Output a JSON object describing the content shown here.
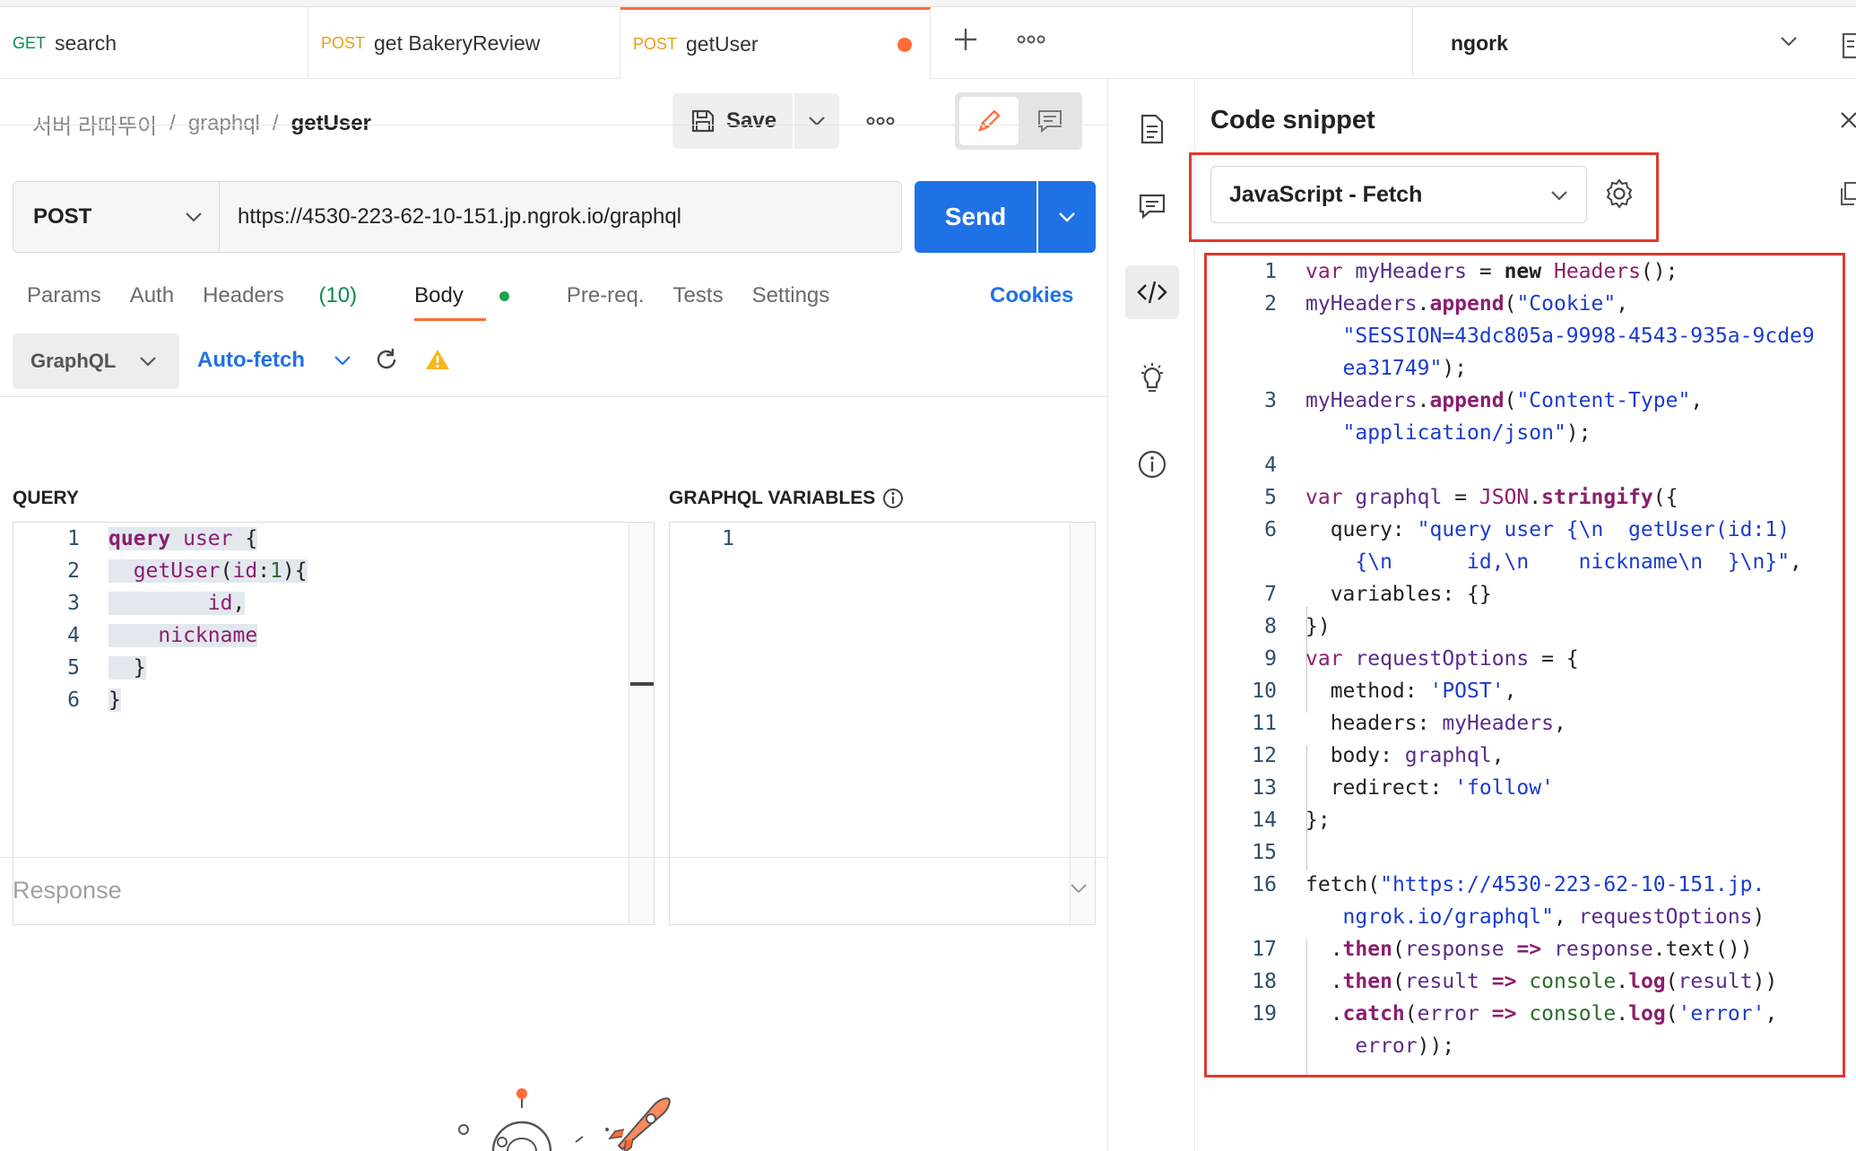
{
  "tabs": [
    {
      "method": "GET",
      "name": "search"
    },
    {
      "method": "POST",
      "name": "get BakeryReview"
    },
    {
      "method": "POST",
      "name": "getUser"
    }
  ],
  "environment": "ngork",
  "breadcrumb": {
    "workspace": "서버 라따뚜이",
    "collection": "graphql",
    "request": "getUser"
  },
  "toolbar": {
    "save_label": "Save"
  },
  "request": {
    "method": "POST",
    "url": "https://4530-223-62-10-151.jp.ngrok.io/graphql",
    "send_label": "Send"
  },
  "request_tabs": {
    "params": "Params",
    "auth": "Auth",
    "headers": "Headers",
    "headers_count": "(10)",
    "body": "Body",
    "prereq": "Pre-req.",
    "tests": "Tests",
    "settings": "Settings",
    "cookies": "Cookies"
  },
  "body": {
    "mode": "GraphQL",
    "autofetch": "Auto-fetch",
    "query_label": "QUERY",
    "variables_label": "GRAPHQL VARIABLES"
  },
  "query_lines": [
    "1",
    "2",
    "3",
    "4",
    "5",
    "6"
  ],
  "variables_lines": [
    "1"
  ],
  "response_label": "Response",
  "snippet": {
    "title": "Code snippet",
    "language": "JavaScript - Fetch",
    "line_numbers": [
      "1",
      "2",
      "",
      "3",
      "",
      "4",
      "5",
      "6",
      "",
      "7",
      "8",
      "9",
      "10",
      "11",
      "12",
      "13",
      "14",
      "15",
      "16",
      "",
      "17",
      "18",
      "19",
      ""
    ]
  },
  "colors": {
    "accent": "#1f72e6",
    "tab_active": "#ff6c37",
    "highlight_box": "#e0382f"
  }
}
